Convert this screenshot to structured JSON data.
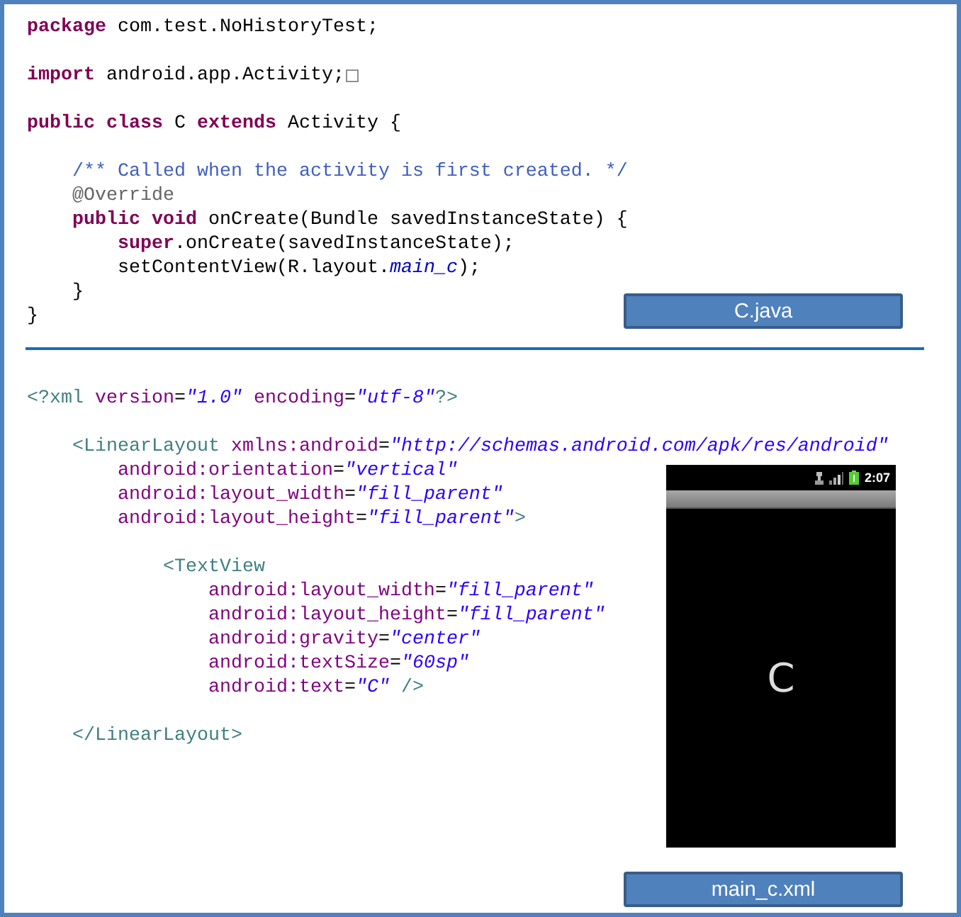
{
  "java_file": {
    "lines": [
      {
        "kind": "code",
        "tokens": [
          {
            "kind": "keyword",
            "text": "package"
          },
          {
            "kind": "plain",
            "text": " com.test.NoHistoryTest;"
          }
        ]
      },
      {
        "kind": "blank"
      },
      {
        "kind": "code",
        "tokens": [
          {
            "kind": "keyword",
            "text": "import"
          },
          {
            "kind": "plain",
            "text": " android.app.Activity;"
          },
          {
            "kind": "fold"
          }
        ]
      },
      {
        "kind": "blank"
      },
      {
        "kind": "code",
        "tokens": [
          {
            "kind": "keyword",
            "text": "public"
          },
          {
            "kind": "keyword",
            "text": " class"
          },
          {
            "kind": "plain",
            "text": " C "
          },
          {
            "kind": "keyword",
            "text": "extends"
          },
          {
            "kind": "plain",
            "text": " Activity {"
          }
        ]
      },
      {
        "kind": "blank"
      },
      {
        "kind": "code",
        "tokens": [
          {
            "kind": "comment",
            "text": "    /** Called when the activity is first created. */"
          }
        ]
      },
      {
        "kind": "code",
        "tokens": [
          {
            "kind": "annotation",
            "text": "    @Override"
          }
        ]
      },
      {
        "kind": "code",
        "tokens": [
          {
            "kind": "keyword",
            "text": "    public"
          },
          {
            "kind": "keyword",
            "text": " void"
          },
          {
            "kind": "plain",
            "text": " onCreate(Bundle savedInstanceState) {"
          }
        ]
      },
      {
        "kind": "code",
        "tokens": [
          {
            "kind": "keyword",
            "text": "        super"
          },
          {
            "kind": "plain",
            "text": ".onCreate(savedInstanceState);"
          }
        ]
      },
      {
        "kind": "code",
        "tokens": [
          {
            "kind": "plain",
            "text": "        setContentView(R.layout."
          },
          {
            "kind": "field",
            "text": "main_c"
          },
          {
            "kind": "plain",
            "text": ");"
          }
        ]
      },
      {
        "kind": "code",
        "tokens": [
          {
            "kind": "plain",
            "text": "    }"
          }
        ]
      },
      {
        "kind": "code",
        "tokens": [
          {
            "kind": "plain",
            "text": "}"
          }
        ]
      }
    ],
    "label": "C.java"
  },
  "xml_file": {
    "header_lines": [
      {
        "kind": "code",
        "tokens": [
          {
            "kind": "tag",
            "text": "<?xml"
          },
          {
            "kind": "attr",
            "text": " version"
          },
          {
            "kind": "plain",
            "text": "="
          },
          {
            "kind": "string",
            "text": "\"1.0\""
          },
          {
            "kind": "attr",
            "text": " encoding"
          },
          {
            "kind": "plain",
            "text": "="
          },
          {
            "kind": "string",
            "text": "\"utf-8\""
          },
          {
            "kind": "tag",
            "text": "?>"
          }
        ]
      },
      {
        "kind": "blank"
      },
      {
        "kind": "code",
        "tokens": [
          {
            "kind": "tag",
            "text": "    <LinearLayout"
          },
          {
            "kind": "attr",
            "text": " xmlns:android"
          },
          {
            "kind": "plain",
            "text": "="
          },
          {
            "kind": "string",
            "text": "\"http://schemas.android.com/apk/res/android\""
          }
        ]
      }
    ],
    "body_lines": [
      {
        "kind": "code",
        "tokens": [
          {
            "kind": "attr",
            "text": "        android:orientation"
          },
          {
            "kind": "plain",
            "text": "="
          },
          {
            "kind": "string",
            "text": "\"vertical\""
          }
        ]
      },
      {
        "kind": "code",
        "tokens": [
          {
            "kind": "attr",
            "text": "        android:layout_width"
          },
          {
            "kind": "plain",
            "text": "="
          },
          {
            "kind": "string",
            "text": "\"fill_parent\""
          }
        ]
      },
      {
        "kind": "code",
        "tokens": [
          {
            "kind": "attr",
            "text": "        android:layout_height"
          },
          {
            "kind": "plain",
            "text": "="
          },
          {
            "kind": "string",
            "text": "\"fill_parent\""
          },
          {
            "kind": "tag",
            "text": ">"
          }
        ]
      },
      {
        "kind": "blank"
      },
      {
        "kind": "code",
        "tokens": [
          {
            "kind": "tag",
            "text": "            <TextView"
          }
        ]
      },
      {
        "kind": "code",
        "tokens": [
          {
            "kind": "attr",
            "text": "                android:layout_width"
          },
          {
            "kind": "plain",
            "text": "="
          },
          {
            "kind": "string",
            "text": "\"fill_parent\""
          }
        ]
      },
      {
        "kind": "code",
        "tokens": [
          {
            "kind": "attr",
            "text": "                android:layout_height"
          },
          {
            "kind": "plain",
            "text": "="
          },
          {
            "kind": "string",
            "text": "\"fill_parent\""
          }
        ]
      },
      {
        "kind": "code",
        "tokens": [
          {
            "kind": "attr",
            "text": "                android:gravity"
          },
          {
            "kind": "plain",
            "text": "="
          },
          {
            "kind": "string",
            "text": "\"center\""
          }
        ]
      },
      {
        "kind": "code",
        "tokens": [
          {
            "kind": "attr",
            "text": "                android:textSize"
          },
          {
            "kind": "plain",
            "text": "="
          },
          {
            "kind": "string",
            "text": "\"60sp\""
          }
        ]
      },
      {
        "kind": "code",
        "tokens": [
          {
            "kind": "attr",
            "text": "                android:text"
          },
          {
            "kind": "plain",
            "text": "="
          },
          {
            "kind": "string",
            "text": "\"C\""
          },
          {
            "kind": "tag",
            "text": " />"
          }
        ]
      },
      {
        "kind": "blank"
      },
      {
        "kind": "code",
        "tokens": [
          {
            "kind": "tag",
            "text": "    </LinearLayout>"
          }
        ]
      }
    ],
    "label": "main_c.xml"
  },
  "emulator": {
    "status_time": "2:07",
    "content_text": "C"
  }
}
